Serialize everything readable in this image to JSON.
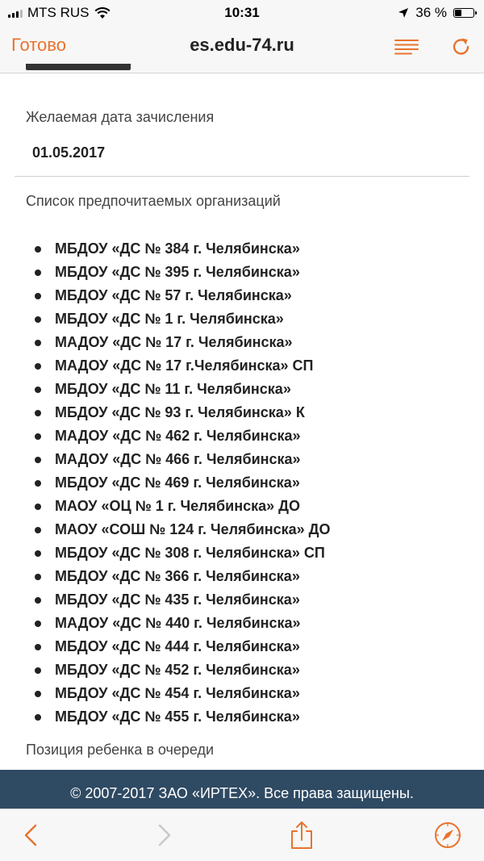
{
  "status_bar": {
    "carrier": "MTS RUS",
    "time": "10:31",
    "battery_text": "36 %",
    "battery_level": 0.36
  },
  "browser": {
    "done_label": "Готово",
    "url": "es.edu-74.ru"
  },
  "form": {
    "desired_date_label": "Желаемая дата зачисления",
    "desired_date_value": "01.05.2017",
    "organizations_label": "Список предпочитаемых организаций",
    "organizations": [
      "МБДОУ «ДС № 384 г. Челябинска»",
      "МБДОУ «ДС № 395 г. Челябинска»",
      "МБДОУ «ДС № 57 г. Челябинска»",
      "МБДОУ «ДС № 1 г. Челябинска»",
      "МАДОУ «ДС № 17 г. Челябинска»",
      "МАДОУ «ДС № 17 г.Челябинска» СП",
      "МБДОУ «ДС № 11 г. Челябинска»",
      "МБДОУ «ДС № 93 г. Челябинска» К",
      "МАДОУ «ДС № 462 г. Челябинска»",
      "МАДОУ «ДС № 466 г. Челябинска»",
      "МБДОУ «ДС № 469 г. Челябинска»",
      "МАОУ «ОЦ № 1 г. Челябинска» ДО",
      "МАОУ «СОШ № 124 г. Челябинска» ДО",
      "МБДОУ «ДС № 308 г. Челябинска» СП",
      "МБДОУ «ДС № 366 г. Челябинска»",
      "МБДОУ «ДС № 435 г. Челябинска»",
      "МАДОУ «ДС № 440 г. Челябинска»",
      "МБДОУ «ДС № 444 г. Челябинска»",
      "МБДОУ «ДС № 452 г. Челябинска»",
      "МБДОУ «ДС № 454 г. Челябинска»",
      "МБДОУ «ДС № 455 г. Челябинска»"
    ],
    "queue_position_label": "Позиция ребенка в очереди"
  },
  "footer": {
    "copyright": "© 2007-2017 ЗАО «ИРТЕХ». Все права защищены."
  },
  "colors": {
    "accent": "#e8732e",
    "footer_bg": "#2f4a63"
  },
  "icons": {
    "back": "chevron-left-icon",
    "forward": "chevron-right-icon",
    "share": "share-icon",
    "safari": "compass-icon",
    "reader": "reader-mode-icon",
    "reload": "reload-icon"
  }
}
